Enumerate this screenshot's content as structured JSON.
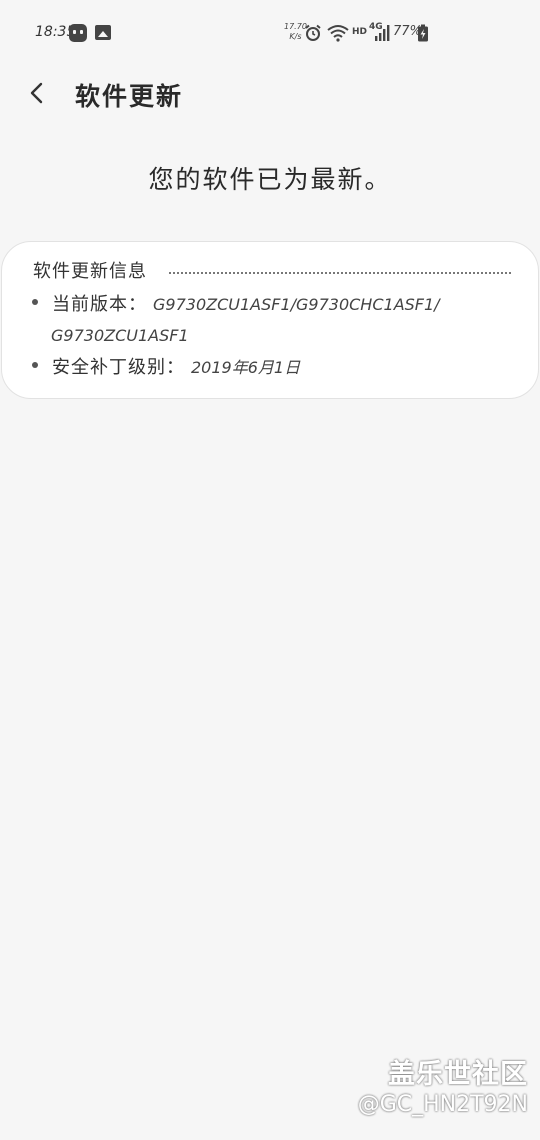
{
  "status_bar": {
    "time": "18:35",
    "net_speed_value": "17.70",
    "net_speed_unit": "K/s",
    "hd_label": "HD",
    "network_type": "4G",
    "battery_percent": "77%"
  },
  "header": {
    "title": "软件更新"
  },
  "main": {
    "status_message": "您的软件已为最新。"
  },
  "info_card": {
    "title": "软件更新信息",
    "version_label": "当前版本：",
    "version_value": "G9730ZCU1ASF1/G9730CHC1ASF1/",
    "version_value_cont": "G9730ZCU1ASF1",
    "patch_label": "安全补丁级别：",
    "patch_value": "2019年6月1日"
  },
  "watermark": {
    "site": "盖乐世社区",
    "user": "@GC_HN2T92N"
  },
  "colors": {
    "background": "#f6f6f6",
    "card": "#ffffff",
    "text": "#2a2a2a"
  }
}
